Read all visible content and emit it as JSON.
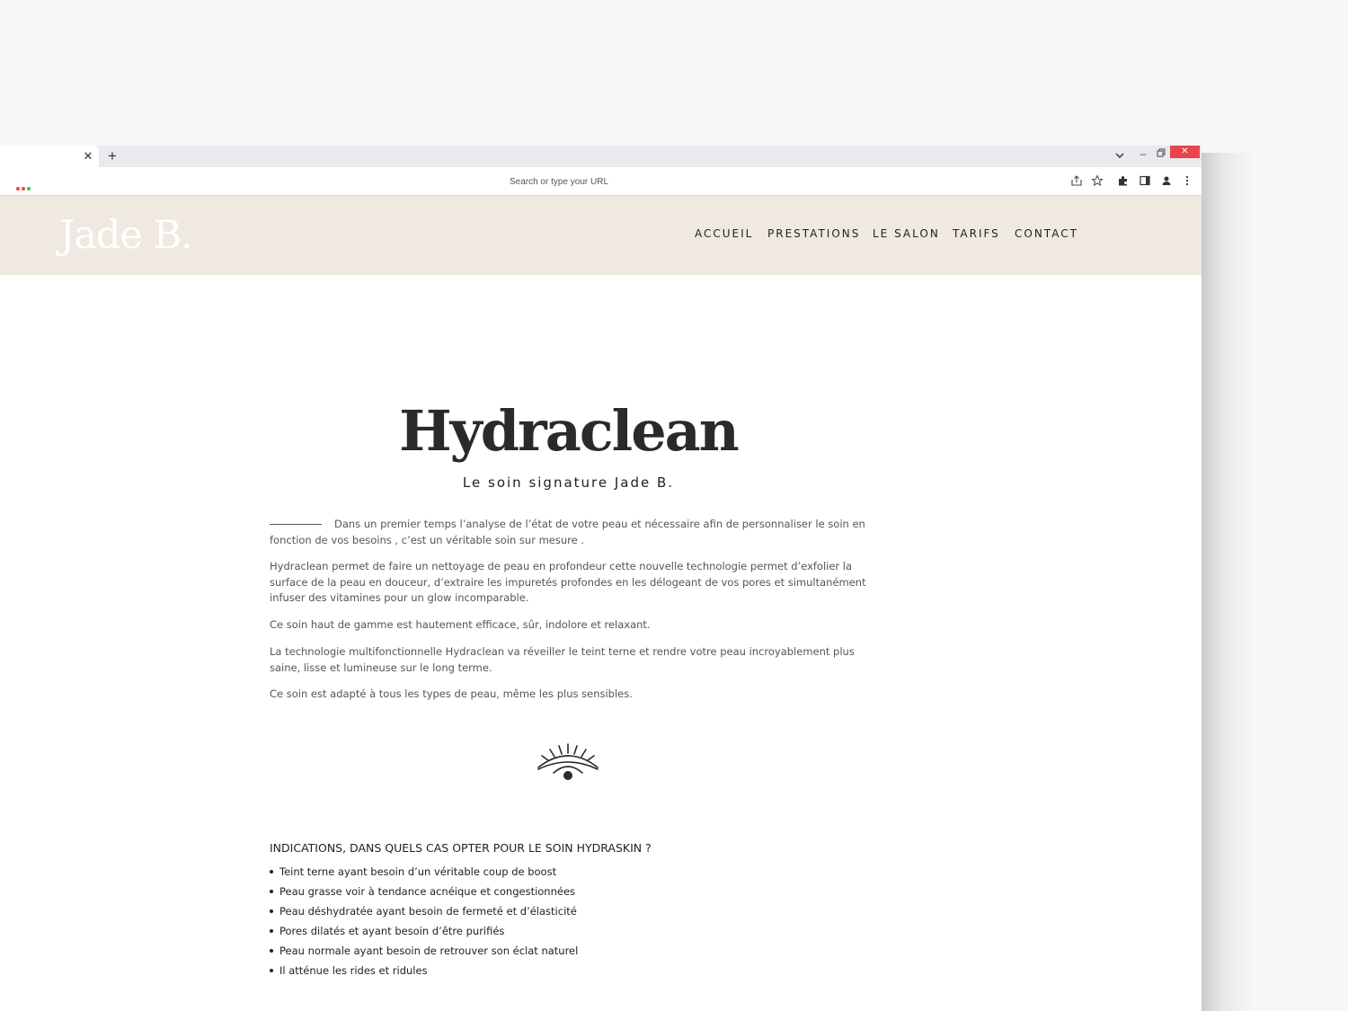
{
  "browser": {
    "tab": {
      "close_glyph": "✕"
    },
    "new_tab_glyph": "+",
    "window": {
      "minimize_glyph": "–",
      "close_glyph": "✕"
    },
    "traffic_dots": [
      "#e8444a",
      "#e8444a",
      "#2ecc40"
    ],
    "address_bar": {
      "placeholder": "Search or type your URL"
    },
    "toolbar_icons": [
      "share-icon",
      "star-icon",
      "puzzle-icon",
      "sidepanel-icon",
      "profile-icon",
      "more-icon"
    ]
  },
  "site": {
    "logo": "Jade B.",
    "nav": [
      "ACCUEIL",
      "PRESTATIONS",
      "LE SALON",
      "TARIFS",
      "CONTACT"
    ],
    "colors": {
      "header_bg": "#efe9e1",
      "text_dark": "#2b2a28"
    }
  },
  "content": {
    "title": "Hydraclean",
    "subtitle": "Le soin signature Jade B.",
    "paragraphs": [
      "Dans un premier temps l’analyse de l’état de votre peau et nécessaire afin de personnaliser le soin en fonction de vos besoins , c’est un véritable soin sur mesure .",
      "Hydraclean permet de faire un nettoyage de peau en profondeur cette nouvelle technologie permet d’exfolier la surface de la peau en douceur, d’extraire les impuretés profondes en les délogeant de vos pores et simultanément infuser des vitamines pour un glow incomparable.",
      "Ce soin haut de gamme est hautement efficace, sûr, indolore et relaxant.",
      "La technologie multifonctionnelle Hydraclean va réveiller le teint terne et rendre votre peau incroyablement plus saine, lisse et lumineuse sur le long terme.",
      "Ce soin est adapté à tous les types de peau, même les plus sensibles."
    ],
    "divider_icon": "eye-icon",
    "indications_title": "INDICATIONS, DANS QUELS CAS OPTER POUR LE SOIN HYDRASKIN ?",
    "indications": [
      "Teint terne ayant besoin d’un véritable coup de boost",
      "Peau grasse voir à tendance acnéique et congestionnées",
      "Peau déshydratée ayant besoin de fermeté et d’élasticité",
      "Pores dilatés et ayant besoin d’être purifiés",
      "Peau normale ayant besoin de retrouver son éclat naturel",
      "Il atténue les rides et ridules"
    ]
  }
}
